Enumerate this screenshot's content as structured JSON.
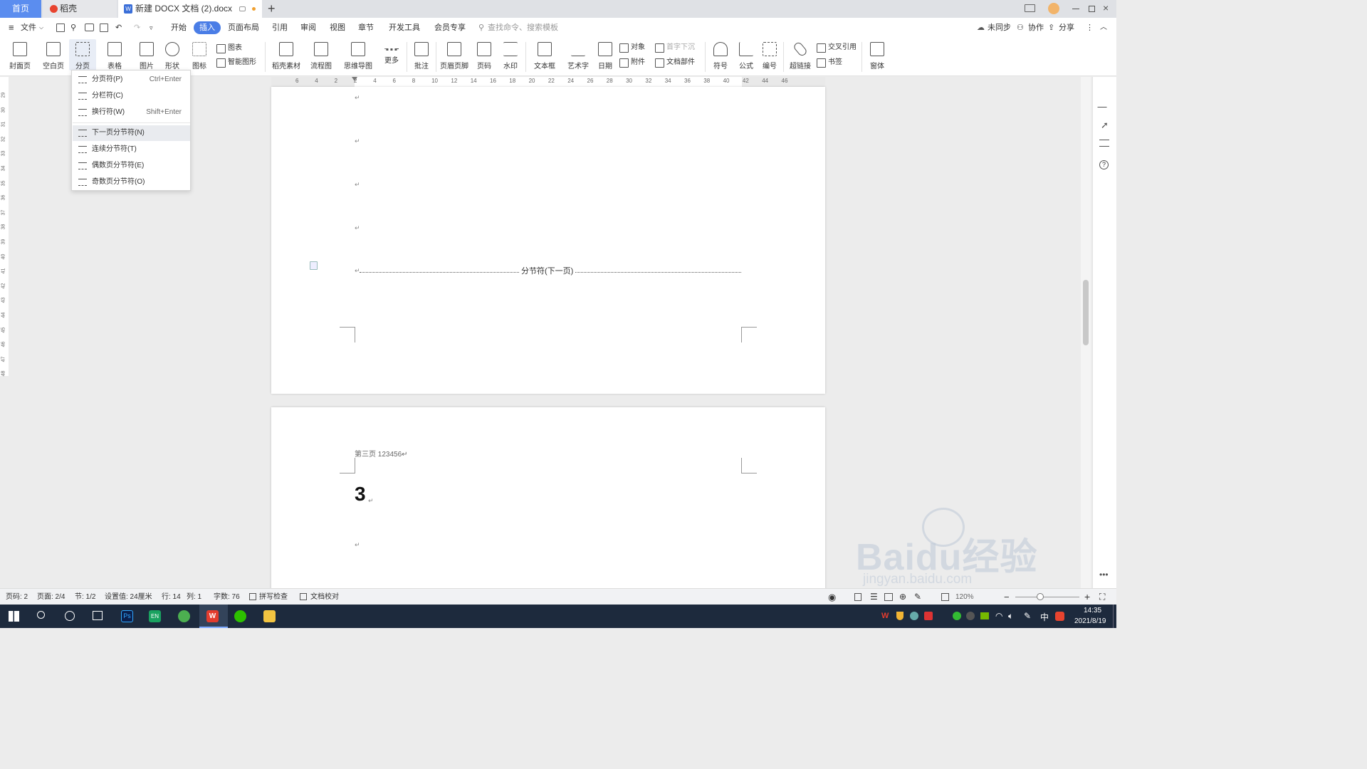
{
  "tabs": {
    "home": "首页",
    "daoke": "稻壳",
    "doc": "新建 DOCX 文档 (2).docx"
  },
  "menubar": {
    "file": "文件",
    "items": [
      "开始",
      "插入",
      "页面布局",
      "引用",
      "审阅",
      "视图",
      "章节",
      "开发工具",
      "会员专享"
    ],
    "active": "插入",
    "search_placeholder": "查找命令、搜索模板",
    "unsync": "未同步",
    "collab": "协作",
    "share": "分享"
  },
  "ribbon": {
    "big_buttons": [
      "封面页",
      "空白页",
      "分页",
      "表格",
      "图片",
      "形状",
      "图标",
      "稻壳素材",
      "流程图",
      "思维导图",
      "更多",
      "批注",
      "页眉页脚",
      "页码",
      "水印",
      "文本框",
      "艺术字",
      "日期",
      "符号",
      "公式",
      "编号",
      "超链接",
      "窗体"
    ],
    "small": {
      "chart": "图表",
      "smart_shape": "智能图形",
      "object": "对象",
      "drop_cap": "首字下沉",
      "attachment": "附件",
      "doc_parts": "文档部件",
      "cross_ref": "交叉引用",
      "bookmark": "书签"
    }
  },
  "dropdown": {
    "items": [
      {
        "label": "分页符(P)",
        "shortcut": "Ctrl+Enter"
      },
      {
        "label": "分栏符(C)",
        "shortcut": ""
      },
      {
        "label": "换行符(W)",
        "shortcut": "Shift+Enter"
      },
      {
        "label": "下一页分节符(N)",
        "shortcut": ""
      },
      {
        "label": "连续分节符(T)",
        "shortcut": ""
      },
      {
        "label": "偶数页分节符(E)",
        "shortcut": ""
      },
      {
        "label": "奇数页分节符(O)",
        "shortcut": ""
      }
    ],
    "highlighted": "下一页分节符(N)"
  },
  "ruler": {
    "ticks": [
      "6",
      "4",
      "2",
      "2",
      "4",
      "6",
      "8",
      "10",
      "12",
      "14",
      "16",
      "18",
      "20",
      "22",
      "24",
      "26",
      "28",
      "30",
      "32",
      "34",
      "36",
      "38",
      "40",
      "42",
      "44",
      "46"
    ]
  },
  "vruler": {
    "ticks": [
      "29",
      "30",
      "31",
      "32",
      "33",
      "34",
      "35",
      "36",
      "37",
      "38",
      "39",
      "40",
      "41",
      "42",
      "43",
      "44",
      "45",
      "46",
      "47",
      "48"
    ]
  },
  "document": {
    "para_mark": "↵",
    "section_break_label": "分节符(下一页)",
    "page3_header": "第三页 123456↵",
    "page3_number": "3"
  },
  "status": {
    "page_code": "页码: 2",
    "pages": "页面: 2/4",
    "section": "节: 1/2",
    "setting": "设置值: 24厘米",
    "row": "行: 14",
    "col": "列: 1",
    "words": "字数: 76",
    "spell": "拼写检查",
    "proof": "文档校对",
    "zoom": "120%"
  },
  "taskbar": {
    "time": "14:35",
    "date": "2021/8/19",
    "ime": "中"
  },
  "watermark": {
    "text": "Baidu经验",
    "url": "jingyan.baidu.com"
  },
  "colors": {
    "accent": "#4a7de6",
    "taskbar": "#1d2a3d"
  }
}
